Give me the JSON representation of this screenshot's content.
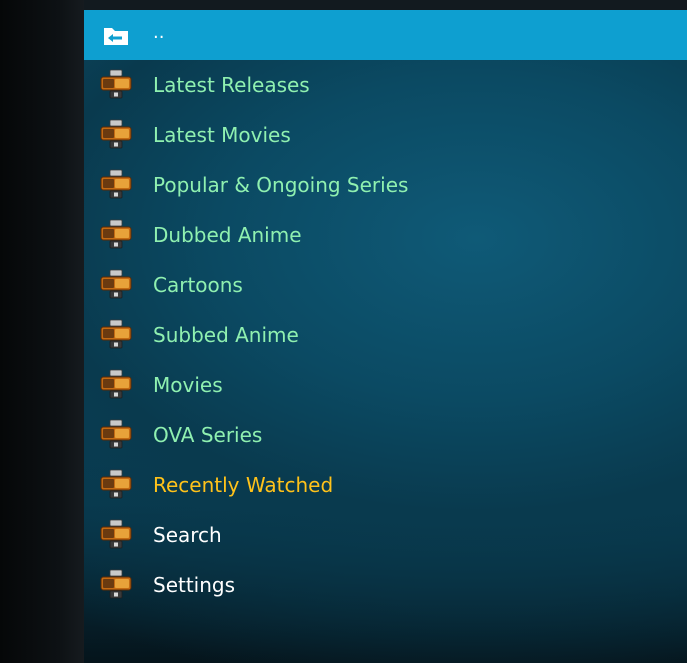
{
  "colors": {
    "selected_highlight": "#0e9fd0",
    "item_label": "#8ff0b0",
    "recently_watched_label": "#ffc21a",
    "plain_label": "#ffffff"
  },
  "list": {
    "parent": {
      "label": "..",
      "icon": "folder-back-icon"
    },
    "items": [
      {
        "label": "Latest Releases",
        "icon": "watch-nyaa-icon"
      },
      {
        "label": "Latest Movies",
        "icon": "watch-nyaa-icon"
      },
      {
        "label": "Popular & Ongoing Series",
        "icon": "watch-nyaa-icon"
      },
      {
        "label": "Dubbed Anime",
        "icon": "watch-nyaa-icon"
      },
      {
        "label": "Cartoons",
        "icon": "watch-nyaa-icon"
      },
      {
        "label": "Subbed Anime",
        "icon": "watch-nyaa-icon"
      },
      {
        "label": "Movies",
        "icon": "watch-nyaa-icon"
      },
      {
        "label": "OVA Series",
        "icon": "watch-nyaa-icon"
      },
      {
        "label": "Recently Watched",
        "icon": "watch-nyaa-icon"
      },
      {
        "label": "Search",
        "icon": "watch-nyaa-icon"
      },
      {
        "label": "Settings",
        "icon": "watch-nyaa-icon"
      }
    ]
  }
}
